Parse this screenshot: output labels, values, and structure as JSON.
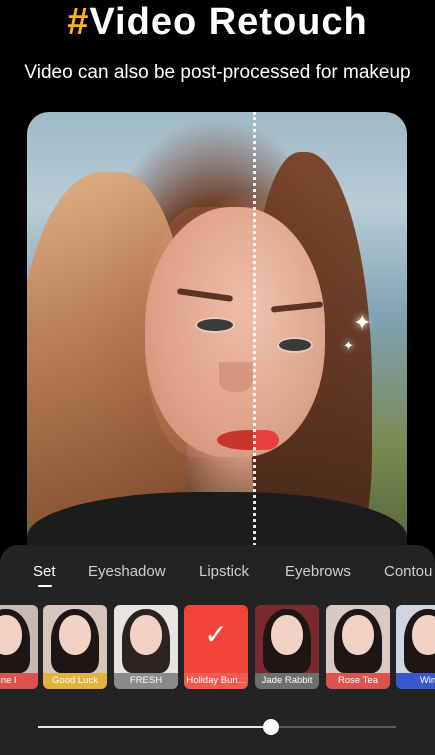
{
  "header": {
    "hash": "#",
    "title": "Video Retouch",
    "subtitle": "Video can also be post-processed for makeup"
  },
  "makeup_panel": {
    "tabs": [
      {
        "label": "Set",
        "active": true
      },
      {
        "label": "Eyeshadow",
        "active": false
      },
      {
        "label": "Lipstick",
        "active": false
      },
      {
        "label": "Eyebrows",
        "active": false
      },
      {
        "label": "Contou",
        "active": false
      }
    ],
    "presets": [
      {
        "label": "une I",
        "caption_color": "#d9534f"
      },
      {
        "label": "Good Luck",
        "caption_color": "#e3b23c"
      },
      {
        "label": "FRESH",
        "caption_color": "#8a8a8a"
      },
      {
        "label": "Holiday Bun...",
        "caption_color": "#f05a4f",
        "selected": true
      },
      {
        "label": "Jade Rabbit",
        "caption_color": "#6e6e6e"
      },
      {
        "label": "Rose Tea",
        "caption_color": "#d9534f"
      },
      {
        "label": "Win",
        "caption_color": "#3a58c9"
      }
    ],
    "intensity": 0.65
  },
  "colors": {
    "accent": "#ffb21a",
    "selected_preset": "#f0443a"
  },
  "icons": {
    "selected": "check-icon",
    "sparkle": "sparkle-icon"
  }
}
